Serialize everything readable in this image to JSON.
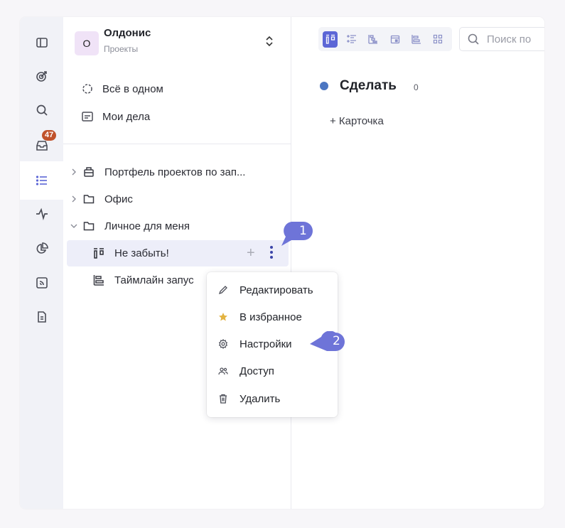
{
  "workspace": {
    "initial": "О",
    "name": "Олдонис",
    "subtitle": "Проекты"
  },
  "rail": {
    "inbox_badge": "47"
  },
  "nav": {
    "all_in_one": "Всё в одном",
    "my_tasks": "Мои дела"
  },
  "tree": [
    {
      "label": "Портфель проектов по зап...",
      "icon": "portfolio-icon"
    },
    {
      "label": "Офис",
      "icon": "folder-icon"
    },
    {
      "label": "Личное для меня",
      "icon": "folder-icon"
    },
    {
      "label": "Не забыть!",
      "icon": "board-icon"
    },
    {
      "label": "Таймлайн запус",
      "icon": "timeline-icon"
    }
  ],
  "row_actions": {
    "plus": "+"
  },
  "search": {
    "placeholder": "Поиск по"
  },
  "column": {
    "title": "Сделать",
    "count": "0",
    "add_card": "+ Карточка",
    "dot_color": "#4c76c2"
  },
  "context_menu": [
    {
      "label": "Редактировать",
      "icon": "pencil-icon"
    },
    {
      "label": "В избранное",
      "icon": "star-icon"
    },
    {
      "label": "Настройки",
      "icon": "gear-icon"
    },
    {
      "label": "Доступ",
      "icon": "users-icon"
    },
    {
      "label": "Удалить",
      "icon": "trash-icon"
    }
  ],
  "callouts": {
    "first": "1",
    "second": "2"
  },
  "colors": {
    "accent": "#5c66d6",
    "callout": "#6e74d8",
    "badge": "#c0522b"
  }
}
